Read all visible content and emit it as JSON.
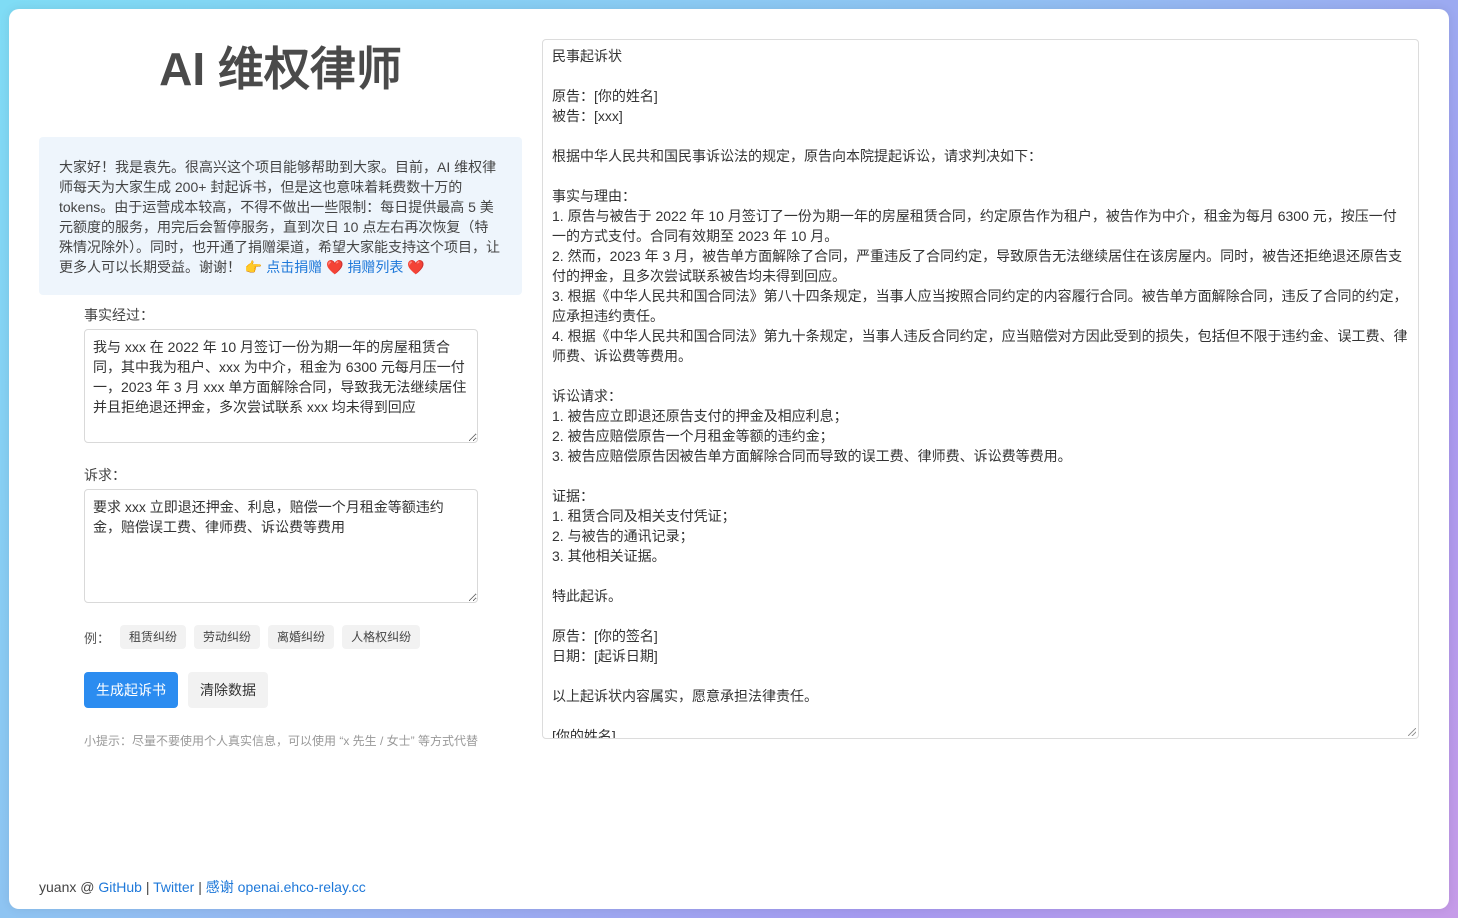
{
  "app": {
    "title": "AI 维权律师"
  },
  "notice": {
    "text": "大家好！我是袁先。很高兴这个项目能够帮助到大家。目前，AI 维权律师每天为大家生成 200+ 封起诉书，但是这也意味着耗费数十万的 tokens。由于运营成本较高，不得不做出一些限制：每日提供最高 5 美元额度的服务，用完后会暂停服务，直到次日 10 点左右再次恢复（特殊情况除外）。同时，也开通了捐赠渠道，希望大家能支持这个项目，让更多人可以长期受益。谢谢！",
    "pointer_emoji": "👉",
    "donate_link": "点击捐赠",
    "heart": "❤️",
    "donor_list_link": "捐赠列表"
  },
  "form": {
    "facts_label": "事实经过：",
    "facts_value": "我与 xxx 在 2022 年 10 月签订一份为期一年的房屋租赁合同，其中我为租户、xxx 为中介，租金为 6300 元每月压一付一，2023 年 3 月 xxx 单方面解除合同，导致我无法继续居住并且拒绝退还押金，多次尝试联系 xxx 均未得到回应",
    "claims_label": "诉求：",
    "claims_value": "要求 xxx 立即退还押金、利息，赔偿一个月租金等额违约金，赔偿误工费、律师费、诉讼费等费用",
    "examples_label": "例：",
    "examples": [
      "租赁纠纷",
      "劳动纠纷",
      "离婚纠纷",
      "人格权纠纷"
    ],
    "generate_button": "生成起诉书",
    "clear_button": "清除数据",
    "tip": "小提示：尽量不要使用个人真实信息，可以使用 “x 先生 / 女士” 等方式代替"
  },
  "output": {
    "text": "民事起诉状\n\n原告：[你的姓名]\n被告：[xxx]\n\n根据中华人民共和国民事诉讼法的规定，原告向本院提起诉讼，请求判决如下：\n\n事实与理由：\n1. 原告与被告于 2022 年 10 月签订了一份为期一年的房屋租赁合同，约定原告作为租户，被告作为中介，租金为每月 6300 元，按压一付一的方式支付。合同有效期至 2023 年 10 月。\n2. 然而，2023 年 3 月，被告单方面解除了合同，严重违反了合同约定，导致原告无法继续居住在该房屋内。同时，被告还拒绝退还原告支付的押金，且多次尝试联系被告均未得到回应。\n3. 根据《中华人民共和国合同法》第八十四条规定，当事人应当按照合同约定的内容履行合同。被告单方面解除合同，违反了合同的约定，应承担违约责任。\n4. 根据《中华人民共和国合同法》第九十条规定，当事人违反合同约定，应当赔偿对方因此受到的损失，包括但不限于违约金、误工费、律师费、诉讼费等费用。\n\n诉讼请求：\n1. 被告应立即退还原告支付的押金及相应利息；\n2. 被告应赔偿原告一个月租金等额的违约金；\n3. 被告应赔偿原告因被告单方面解除合同而导致的误工费、律师费、诉讼费等费用。\n\n证据：\n1. 租赁合同及相关支付凭证；\n2. 与被告的通讯记录；\n3. 其他相关证据。\n\n特此起诉。\n\n原告：[你的签名]\n日期：[起诉日期]\n\n以上起诉状内容属实，愿意承担法律责任。\n\n[你的姓名]"
  },
  "footer": {
    "author": "yuanx @ ",
    "github": "GitHub",
    "sep1": " | ",
    "twitter": "Twitter",
    "sep2": " | ",
    "thanks": "感谢 openai.ehco-relay.cc"
  }
}
